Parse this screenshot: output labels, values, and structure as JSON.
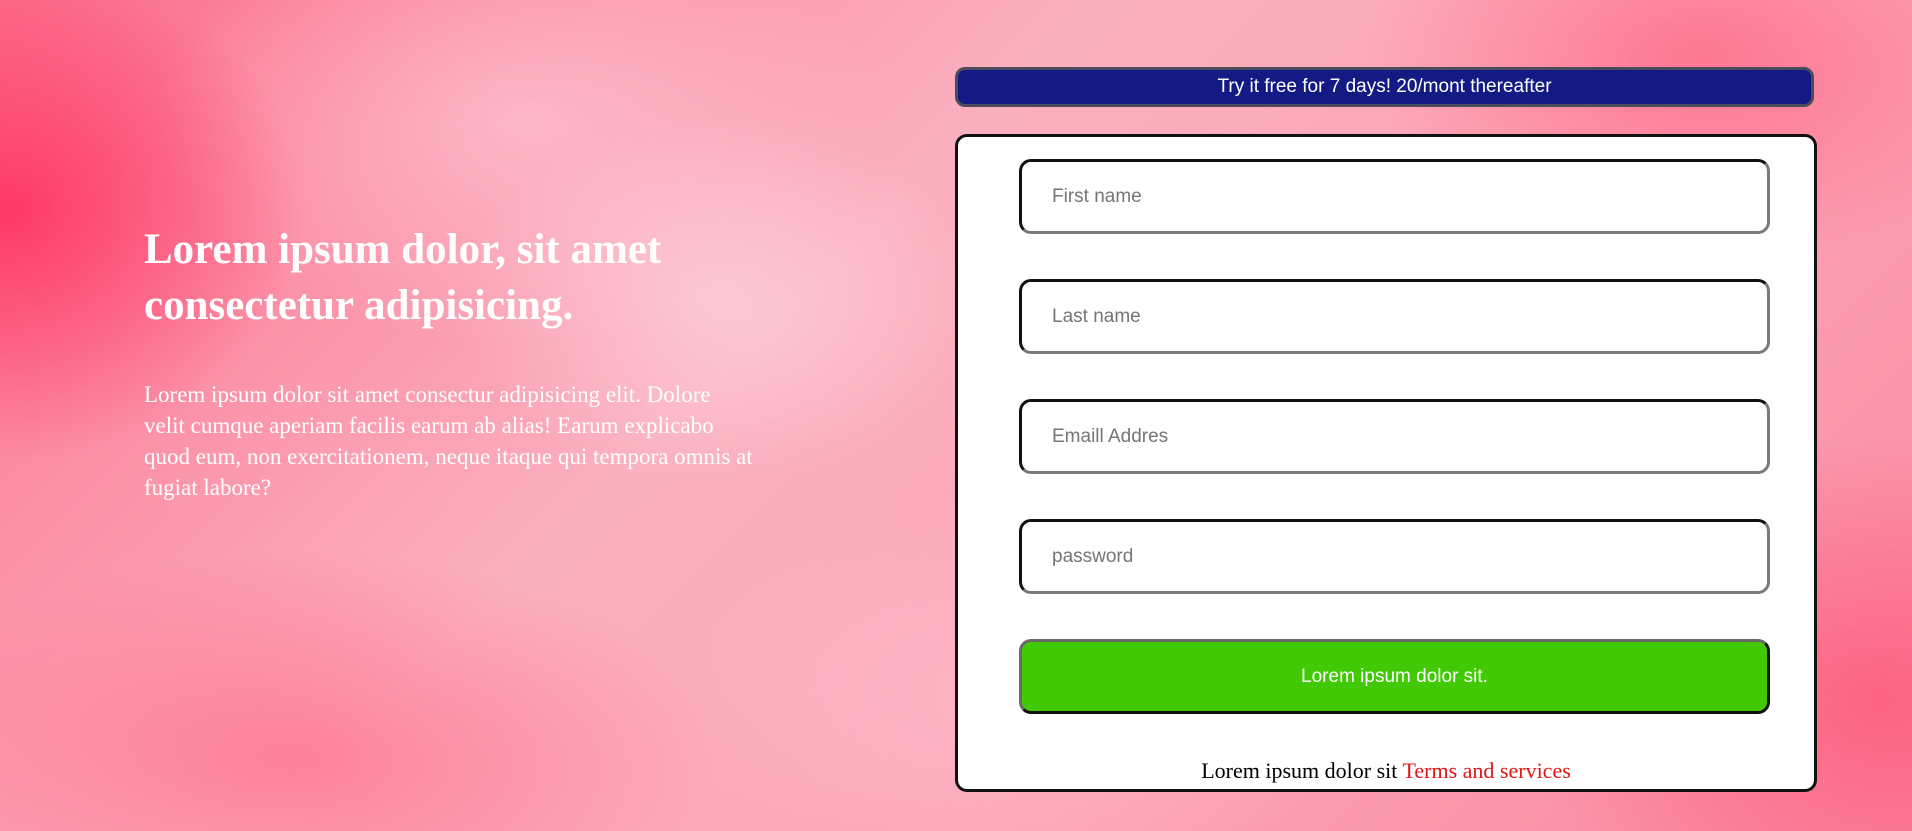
{
  "hero": {
    "title": "Lorem ipsum dolor, sit amet consectetur adipisicing.",
    "text": "Lorem ipsum dolor sit amet consectur adipisicing elit. Dolore velit cumque aperiam facilis earum ab alias! Earum explicabo quod eum, non exercitationem, neque itaque qui tempora omnis at fugiat labore?"
  },
  "banner": {
    "text": "Try it free for 7 days! 20/mont thereafter"
  },
  "form": {
    "fields": [
      {
        "placeholder": "First name",
        "value": ""
      },
      {
        "placeholder": "Last name",
        "value": ""
      },
      {
        "placeholder": "Emaill Addres",
        "value": ""
      },
      {
        "placeholder": "password",
        "value": ""
      }
    ],
    "submit_label": "Lorem ipsum dolor sit.",
    "terms_text": "Lorem ipsum dolor sit",
    "terms_link": "Terms and services"
  },
  "colors": {
    "banner_background": "#141a83",
    "submit_background": "#40c904",
    "terms_link": "#e01414",
    "page_accent": "#fb6f8d"
  }
}
